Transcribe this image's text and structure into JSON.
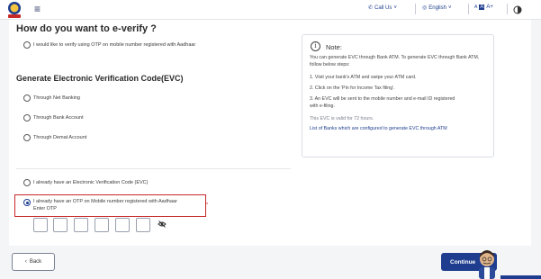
{
  "header": {
    "call_us": "Call Us",
    "language": "English",
    "font_controls": {
      "decrease": "A",
      "normal": "A",
      "increase": "A+"
    }
  },
  "main": {
    "title": "How do you want to e-verify ?",
    "aadhaar_option": "I would like to verify using OTP on mobile number registered with Aadhaar",
    "evc_heading": "Generate Electronic Verification Code(EVC)",
    "evc_options": [
      "Through Net Banking",
      "Through Bank Account",
      "Through Demat Account"
    ],
    "already_evc": "I already have an Electronic Verification Code (EVC)",
    "already_otp": "I already have an OTP on Mobile number registered with Aadhaar",
    "enter_otp_label": "Enter OTP",
    "required_marker": "*",
    "selected_option": "already_otp"
  },
  "note": {
    "title": "Note:",
    "intro": "You can generate EVC through Bank ATM. To generate EVC through Bank ATM, follow below steps:",
    "steps": [
      "1. Visit your bank's ATM and swipe your ATM card.",
      "2. Click on the 'Pin for Income Tax filing'.",
      "3. An EVC will be sent to the mobile number and e-mail ID registered with e-filing."
    ],
    "validity": "This EVC is valid for 72 hours.",
    "link": "List of Banks which are configured to generate EVC through ATM"
  },
  "footer": {
    "back_label": "Back",
    "continue_label": "Continue"
  },
  "colors": {
    "primary": "#1e3d8f",
    "highlight_border": "#c62828",
    "link": "#1f3f8f"
  },
  "icons": [
    "emblem-logo",
    "hamburger-icon",
    "phone-icon",
    "globe-icon",
    "chevron-down-icon",
    "contrast-icon",
    "info-icon",
    "eye-off-icon",
    "chevron-left-icon",
    "assistant-avatar"
  ]
}
